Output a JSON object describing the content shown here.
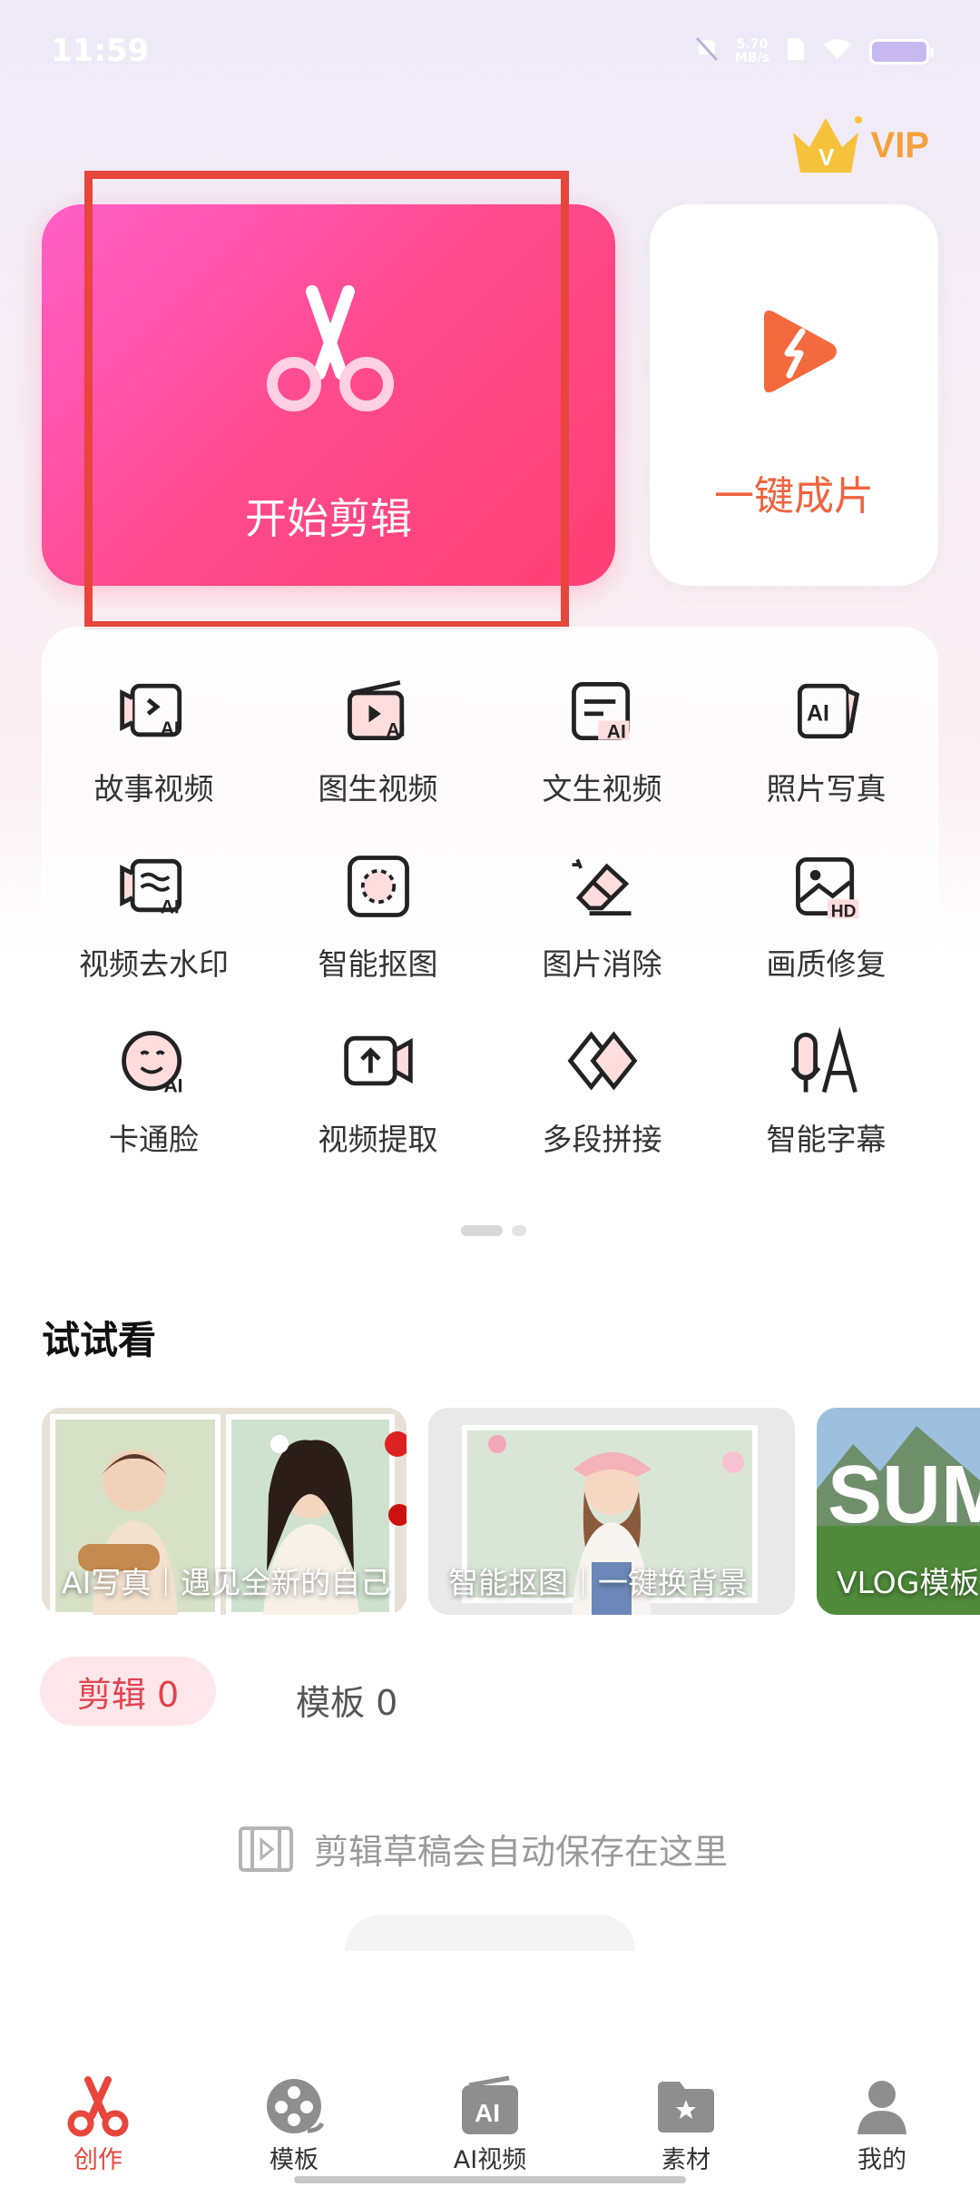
{
  "status_bar": {
    "time": "11:59",
    "net_speed_value": "5.70",
    "net_speed_unit": "MB/s"
  },
  "vip": {
    "label": "VIP"
  },
  "main_cards": {
    "start_edit": "开始剪辑",
    "one_click": "一键成片"
  },
  "tools": [
    {
      "label": "故事视频",
      "icon": "story-video-icon"
    },
    {
      "label": "图生视频",
      "icon": "image-to-video-icon"
    },
    {
      "label": "文生视频",
      "icon": "text-to-video-icon"
    },
    {
      "label": "照片写真",
      "icon": "ai-photo-icon"
    },
    {
      "label": "视频去水印",
      "icon": "remove-watermark-icon"
    },
    {
      "label": "智能抠图",
      "icon": "smart-cutout-icon"
    },
    {
      "label": "图片消除",
      "icon": "eraser-icon"
    },
    {
      "label": "画质修复",
      "icon": "hd-repair-icon"
    },
    {
      "label": "卡通脸",
      "icon": "cartoon-face-icon"
    },
    {
      "label": "视频提取",
      "icon": "video-extract-icon"
    },
    {
      "label": "多段拼接",
      "icon": "multi-segment-icon"
    },
    {
      "label": "智能字幕",
      "icon": "smart-subtitle-icon"
    }
  ],
  "try_section": {
    "title": "试试看",
    "banners": [
      {
        "label": "AI写真｜遇见全新的自己"
      },
      {
        "label": "智能抠图｜一键换背景"
      },
      {
        "label": "VLOG模板",
        "overlay_text": "SUM"
      }
    ]
  },
  "tabs": {
    "edit": "剪辑 0",
    "template": "模板 0"
  },
  "empty_hint": "剪辑草稿会自动保存在这里",
  "bottom_nav": [
    {
      "label": "创作",
      "icon": "scissors-icon",
      "active": true
    },
    {
      "label": "模板",
      "icon": "film-reel-icon",
      "active": false
    },
    {
      "label": "AI视频",
      "icon": "ai-video-icon",
      "active": false
    },
    {
      "label": "素材",
      "icon": "folder-icon",
      "active": false
    },
    {
      "label": "我的",
      "icon": "person-icon",
      "active": false
    }
  ],
  "colors": {
    "accent": "#e8453c",
    "primary_pink": "#ff4a8c",
    "orange": "#f0643f",
    "vip_gold": "#f2a23a"
  }
}
